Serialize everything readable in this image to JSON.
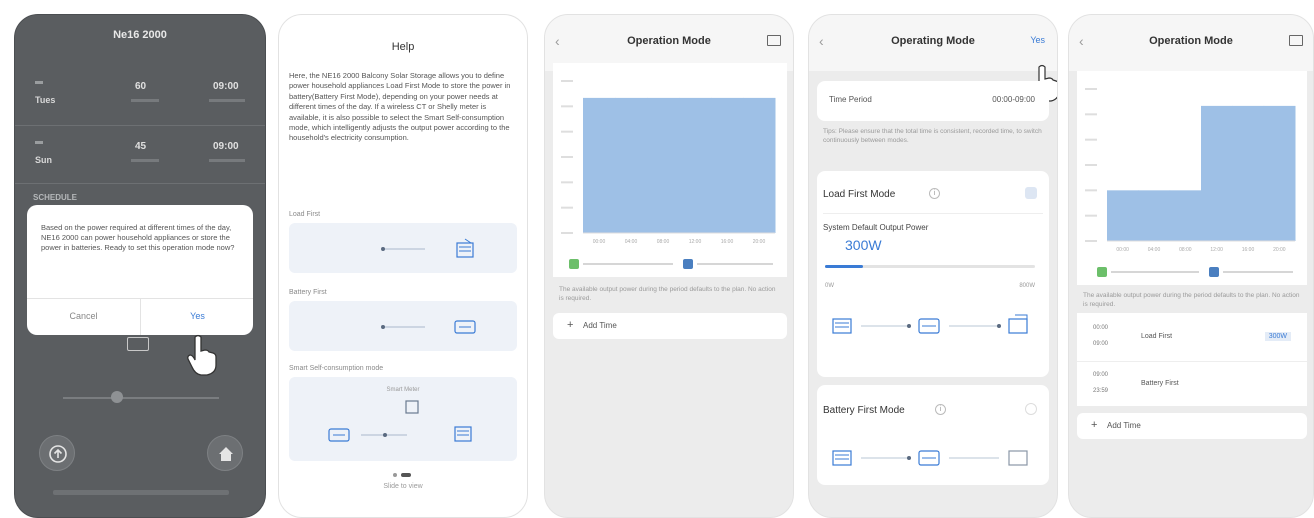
{
  "colors": {
    "accent": "#3a7bd5",
    "bar": "#9ec0e6",
    "legend_green": "#6cbf6a",
    "legend_blue": "#4a7fc0",
    "dark_bg": "#5a5d60"
  },
  "screen1": {
    "title": "Ne16 2000",
    "rows": [
      {
        "label": "Tues",
        "val1": "60",
        "val2": "09:00"
      },
      {
        "label": "Sun",
        "val1": "45",
        "val2": "09:00"
      }
    ],
    "section": "SCHEDULE",
    "dialog": {
      "message": "Based on the power required at different times of the day, NE16 2000 can power household appliances or store the power in batteries. Ready to set this operation mode now?",
      "cancel": "Cancel",
      "confirm": "Yes"
    }
  },
  "screen2": {
    "title": "Help",
    "body": "Here, the NE16 2000 Balcony Solar Storage allows you to define power household appliances Load First Mode to store the power in battery(Battery First Mode), depending on your power needs at different times of the day. If a wireless CT or Shelly meter is available, it is also possible to select the Smart Self-consumption mode, which intelligently adjusts the output power according to the household's electricity consumption.",
    "sections": [
      {
        "label": "Load First"
      },
      {
        "label": "Battery First"
      },
      {
        "label": "Smart Self-consumption mode",
        "meter": "Smart Meter"
      }
    ],
    "pager": "Slide to view"
  },
  "screen3": {
    "title": "Operation Mode",
    "note": "The available output power during the period defaults to the plan. No action is required.",
    "add": "Add Time",
    "chart_data": {
      "type": "bar",
      "categories": [
        "00:00",
        "04:00",
        "08:00",
        "12:00",
        "16:00",
        "20:00"
      ],
      "series": [
        {
          "values": [
            800,
            800,
            800,
            800,
            800,
            800
          ]
        }
      ],
      "ylim": [
        0,
        900
      ]
    }
  },
  "screen4": {
    "title": "Operating Mode",
    "save": "Yes",
    "time_label": "Time Period",
    "time_value": "00:00-09:00",
    "hint": "Tips: Please ensure that the total time is consistent, recorded time, to switch continuously between modes.",
    "load_first": {
      "title": "Load First Mode",
      "output_label": "System Default Output Power",
      "output_value": "300W",
      "min": "0W",
      "max": "800W",
      "level": 0.18
    },
    "battery_first": {
      "title": "Battery First Mode"
    }
  },
  "screen5": {
    "title": "Operation Mode",
    "note": "The available output power during the period defaults to the plan. No action is required.",
    "chart_data": {
      "type": "bar",
      "categories": [
        "00:00",
        "04:00",
        "08:00",
        "12:00",
        "16:00",
        "20:00"
      ],
      "series": [
        {
          "values": [
            300,
            300,
            300,
            800,
            800,
            800
          ]
        }
      ],
      "ylim": [
        0,
        900
      ]
    },
    "schedule": [
      {
        "start": "00:00",
        "end": "09:00",
        "mode": "Load First",
        "power": "300W"
      },
      {
        "start": "09:00",
        "end": "23:59",
        "mode": "Battery First",
        "power": ""
      }
    ],
    "add": "Add Time"
  }
}
